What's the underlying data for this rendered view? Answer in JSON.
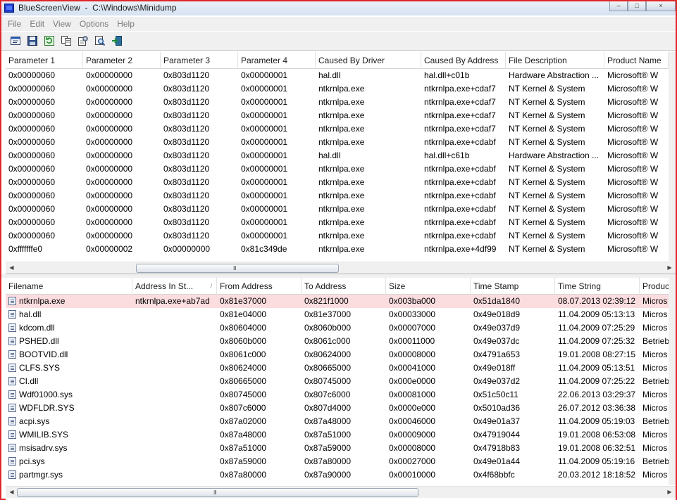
{
  "window": {
    "title": "BlueScreenView  -  C:\\Windows\\Minidump",
    "controls": [
      "–",
      "□",
      "×"
    ]
  },
  "menu": [
    "File",
    "Edit",
    "View",
    "Options",
    "Help"
  ],
  "toolbar": [
    "properties-icon",
    "save-icon",
    "refresh-icon",
    "copy-icon",
    "options-icon",
    "find-icon",
    "exit-icon"
  ],
  "top_table": {
    "columns": [
      "Parameter 1",
      "Parameter 2",
      "Parameter 3",
      "Parameter 4",
      "Caused By Driver",
      "Caused By Address",
      "File Description",
      "Product Name"
    ],
    "rows": [
      [
        "0x00000060",
        "0x00000000",
        "0x803d1120",
        "0x00000001",
        "hal.dll",
        "hal.dll+c01b",
        "Hardware Abstraction ...",
        "Microsoft® W"
      ],
      [
        "0x00000060",
        "0x00000000",
        "0x803d1120",
        "0x00000001",
        "ntkrnlpa.exe",
        "ntkrnlpa.exe+cdaf7",
        "NT Kernel & System",
        "Microsoft® W"
      ],
      [
        "0x00000060",
        "0x00000000",
        "0x803d1120",
        "0x00000001",
        "ntkrnlpa.exe",
        "ntkrnlpa.exe+cdaf7",
        "NT Kernel & System",
        "Microsoft® W"
      ],
      [
        "0x00000060",
        "0x00000000",
        "0x803d1120",
        "0x00000001",
        "ntkrnlpa.exe",
        "ntkrnlpa.exe+cdaf7",
        "NT Kernel & System",
        "Microsoft® W"
      ],
      [
        "0x00000060",
        "0x00000000",
        "0x803d1120",
        "0x00000001",
        "ntkrnlpa.exe",
        "ntkrnlpa.exe+cdaf7",
        "NT Kernel & System",
        "Microsoft® W"
      ],
      [
        "0x00000060",
        "0x00000000",
        "0x803d1120",
        "0x00000001",
        "ntkrnlpa.exe",
        "ntkrnlpa.exe+cdabf",
        "NT Kernel & System",
        "Microsoft® W"
      ],
      [
        "0x00000060",
        "0x00000000",
        "0x803d1120",
        "0x00000001",
        "hal.dll",
        "hal.dll+c61b",
        "Hardware Abstraction ...",
        "Microsoft® W"
      ],
      [
        "0x00000060",
        "0x00000000",
        "0x803d1120",
        "0x00000001",
        "ntkrnlpa.exe",
        "ntkrnlpa.exe+cdabf",
        "NT Kernel & System",
        "Microsoft® W"
      ],
      [
        "0x00000060",
        "0x00000000",
        "0x803d1120",
        "0x00000001",
        "ntkrnlpa.exe",
        "ntkrnlpa.exe+cdabf",
        "NT Kernel & System",
        "Microsoft® W"
      ],
      [
        "0x00000060",
        "0x00000000",
        "0x803d1120",
        "0x00000001",
        "ntkrnlpa.exe",
        "ntkrnlpa.exe+cdabf",
        "NT Kernel & System",
        "Microsoft® W"
      ],
      [
        "0x00000060",
        "0x00000000",
        "0x803d1120",
        "0x00000001",
        "ntkrnlpa.exe",
        "ntkrnlpa.exe+cdabf",
        "NT Kernel & System",
        "Microsoft® W"
      ],
      [
        "0x00000060",
        "0x00000000",
        "0x803d1120",
        "0x00000001",
        "ntkrnlpa.exe",
        "ntkrnlpa.exe+cdabf",
        "NT Kernel & System",
        "Microsoft® W"
      ],
      [
        "0x00000060",
        "0x00000000",
        "0x803d1120",
        "0x00000001",
        "ntkrnlpa.exe",
        "ntkrnlpa.exe+cdabf",
        "NT Kernel & System",
        "Microsoft® W"
      ],
      [
        "0xfffffffe0",
        "0x00000002",
        "0x00000000",
        "0x81c349de",
        "ntkrnlpa.exe",
        "ntkrnlpa.exe+4df99",
        "NT Kernel & System",
        "Microsoft® W"
      ]
    ]
  },
  "bottom_table": {
    "columns": [
      "Filename",
      "Address In St...",
      "From Address",
      "To Address",
      "Size",
      "Time Stamp",
      "Time String",
      "Product"
    ],
    "sort_indicator": "/",
    "rows": [
      [
        "ntkrnlpa.exe",
        "ntkrnlpa.exe+ab7ad",
        "0x81e37000",
        "0x821f1000",
        "0x003ba000",
        "0x51da1840",
        "08.07.2013 02:39:12",
        "Micros"
      ],
      [
        "hal.dll",
        "",
        "0x81e04000",
        "0x81e37000",
        "0x00033000",
        "0x49e018d9",
        "11.04.2009 05:13:13",
        "Micros"
      ],
      [
        "kdcom.dll",
        "",
        "0x80604000",
        "0x8060b000",
        "0x00007000",
        "0x49e037d9",
        "11.04.2009 07:25:29",
        "Micros"
      ],
      [
        "PSHED.dll",
        "",
        "0x8060b000",
        "0x8061c000",
        "0x00011000",
        "0x49e037dc",
        "11.04.2009 07:25:32",
        "Betrieb"
      ],
      [
        "BOOTVID.dll",
        "",
        "0x8061c000",
        "0x80624000",
        "0x00008000",
        "0x4791a653",
        "19.01.2008 08:27:15",
        "Micros"
      ],
      [
        "CLFS.SYS",
        "",
        "0x80624000",
        "0x80665000",
        "0x00041000",
        "0x49e018ff",
        "11.04.2009 05:13:51",
        "Micros"
      ],
      [
        "CI.dll",
        "",
        "0x80665000",
        "0x80745000",
        "0x000e0000",
        "0x49e037d2",
        "11.04.2009 07:25:22",
        "Betrieb"
      ],
      [
        "Wdf01000.sys",
        "",
        "0x80745000",
        "0x807c6000",
        "0x00081000",
        "0x51c50c11",
        "22.06.2013 03:29:37",
        "Micros"
      ],
      [
        "WDFLDR.SYS",
        "",
        "0x807c6000",
        "0x807d4000",
        "0x0000e000",
        "0x5010ad36",
        "26.07.2012 03:36:38",
        "Micros"
      ],
      [
        "acpi.sys",
        "",
        "0x87a02000",
        "0x87a48000",
        "0x00046000",
        "0x49e01a37",
        "11.04.2009 05:19:03",
        "Betrieb"
      ],
      [
        "WMILIB.SYS",
        "",
        "0x87a48000",
        "0x87a51000",
        "0x00009000",
        "0x47919044",
        "19.01.2008 06:53:08",
        "Micros"
      ],
      [
        "msisadrv.sys",
        "",
        "0x87a51000",
        "0x87a59000",
        "0x00008000",
        "0x47918b83",
        "19.01.2008 06:32:51",
        "Micros"
      ],
      [
        "pci.sys",
        "",
        "0x87a59000",
        "0x87a80000",
        "0x00027000",
        "0x49e01a44",
        "11.04.2009 05:19:16",
        "Betrieb"
      ],
      [
        "partmgr.sys",
        "",
        "0x87a80000",
        "0x87a90000",
        "0x00010000",
        "0x4f68bbfc",
        "20.03.2012 18:18:52",
        "Micros"
      ]
    ],
    "selected_row": 0
  },
  "scrollbar_grip": "III",
  "colors": {
    "frame": "#e0262a",
    "selected_row": "#fbdde0",
    "menu_text": "#7a7a7a"
  }
}
